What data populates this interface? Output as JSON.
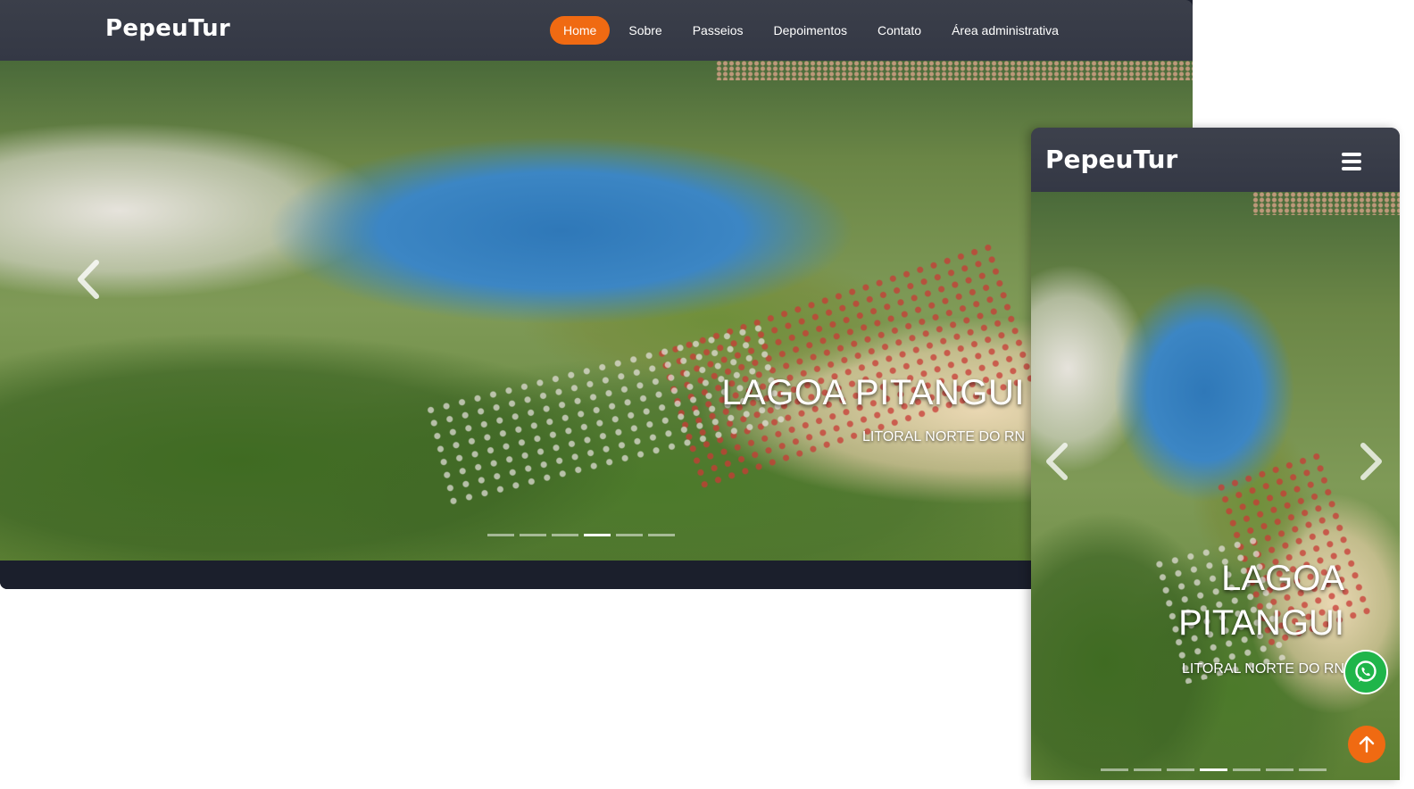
{
  "site": {
    "brand": "PepeuTur"
  },
  "desktop": {
    "nav": {
      "items": [
        "Home",
        "Sobre",
        "Passeios",
        "Depoimentos",
        "Contato",
        "Área administrativa"
      ],
      "active": "Home"
    },
    "carousel": {
      "title": "LAGOA PITANGUI",
      "subtitle": "LITORAL NORTE DO RN",
      "slide_count": 6,
      "active_index": 3
    }
  },
  "mobile": {
    "menu_icon": "hamburger-icon",
    "carousel": {
      "title": "LAGOA PITANGUI",
      "subtitle": "LITORAL NORTE DO RN",
      "slide_count": 7,
      "active_index": 3
    },
    "floating": {
      "whatsapp_icon": "whatsapp-icon",
      "back_to_top_icon": "arrow-up-icon"
    }
  },
  "colors": {
    "accent": "#f06a12",
    "navbar": "#343845",
    "whatsapp": "#1fb54a",
    "footer": "#1b1f2c"
  }
}
